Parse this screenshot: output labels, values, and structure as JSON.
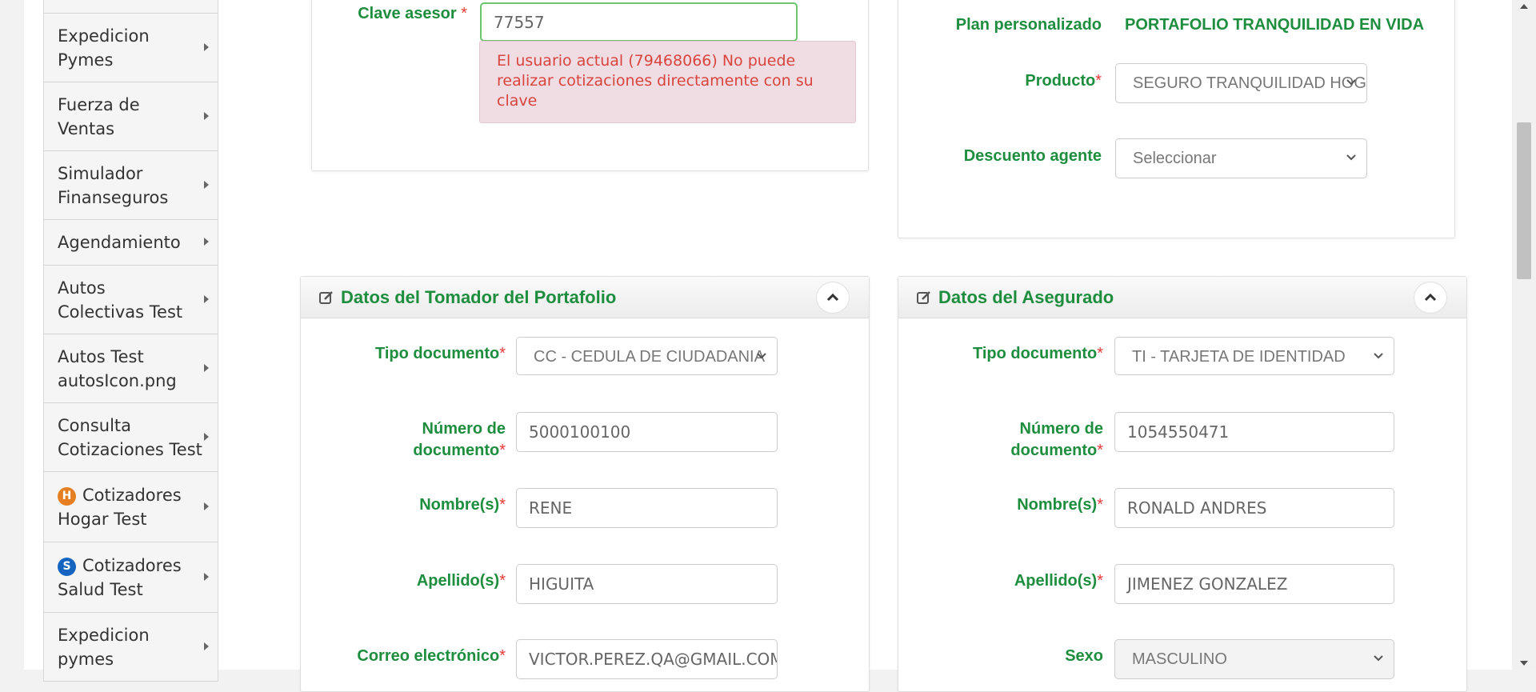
{
  "sidebar": {
    "items": [
      {
        "label": "Expedicion Pymes"
      },
      {
        "label": "Fuerza de Ventas"
      },
      {
        "label": "Simulador Finanseguros"
      },
      {
        "label": "Agendamiento"
      },
      {
        "label": "Autos Colectivas Test"
      },
      {
        "label": "Autos Test autosIcon.png"
      },
      {
        "label": "Consulta Cotizaciones Test"
      },
      {
        "label": "Cotizadores Hogar Test",
        "badge": "H",
        "badge_color": "#e67e22"
      },
      {
        "label": "Cotizadores Salud Test",
        "badge": "S",
        "badge_color": "#1565c0"
      },
      {
        "label": "Expedicion pymes"
      }
    ]
  },
  "asesor": {
    "label": "Clave asesor",
    "required_mark": "*",
    "value": "77557",
    "error_message": "El usuario actual (79468066) No puede realizar cotizaciones directamente con su clave"
  },
  "plan": {
    "plan_label": "Plan personalizado",
    "plan_value": "PORTAFOLIO TRANQUILIDAD EN VIDA",
    "producto_label": "Producto",
    "producto_value": "SEGURO TRANQUILIDAD HOGAR",
    "descuento_label": "Descuento agente",
    "descuento_value": "Seleccionar"
  },
  "tomador": {
    "title": "Datos del Tomador del Portafolio",
    "tipo_doc_label": "Tipo documento",
    "tipo_doc_value": "CC - CEDULA DE CIUDADANIA",
    "num_doc_label_1": "Número de",
    "num_doc_label_2": "documento",
    "num_doc_value": "5000100100",
    "nombres_label": "Nombre(s)",
    "nombres_value": "RENE",
    "apellidos_label": "Apellido(s)",
    "apellidos_value": "HIGUITA",
    "correo_label": "Correo electrónico",
    "correo_value": "VICTOR.PEREZ.QA@GMAIL.COM"
  },
  "asegurado": {
    "title": "Datos del Asegurado",
    "tipo_doc_label": "Tipo documento",
    "tipo_doc_value": "TI - TARJETA DE IDENTIDAD",
    "num_doc_label_1": "Número de",
    "num_doc_label_2": "documento",
    "num_doc_value": "1054550471",
    "nombres_label": "Nombre(s)",
    "nombres_value": "RONALD ANDRES",
    "apellidos_label": "Apellido(s)",
    "apellidos_value": "JIMENEZ GONZALEZ",
    "sexo_label": "Sexo",
    "sexo_value": "MASCULINO"
  },
  "required_mark": "*",
  "colors": {
    "label_green": "#1e8e3e",
    "required_red": "#e53935",
    "error_bg": "#f0dde3",
    "error_text": "#d9443d",
    "valid_border": "#6cc46c"
  }
}
